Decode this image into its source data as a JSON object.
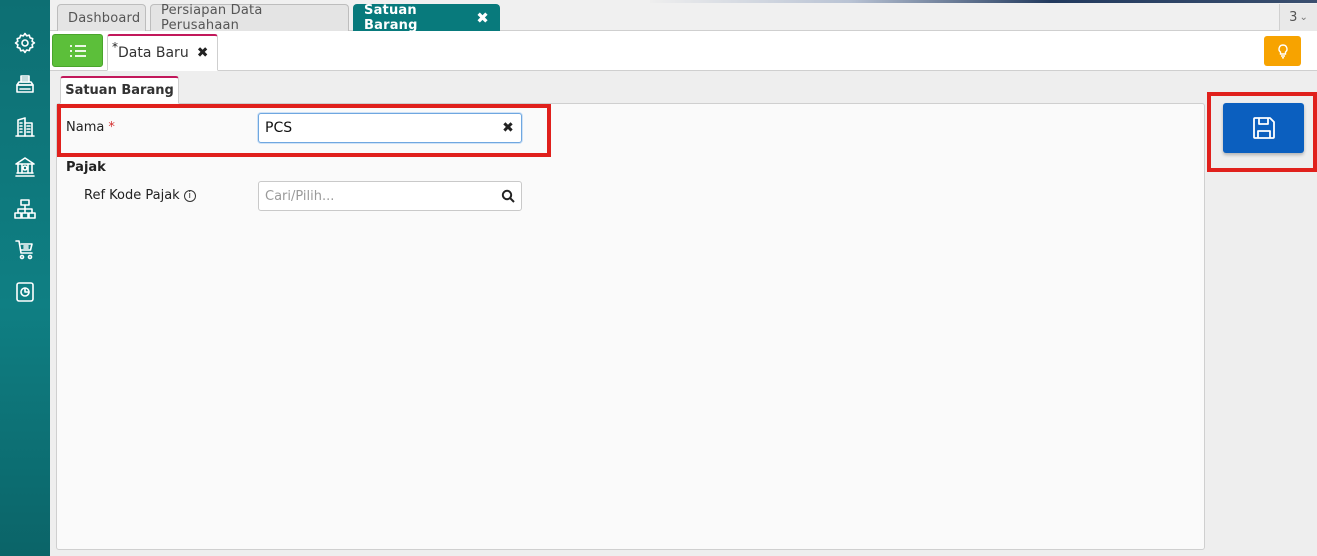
{
  "sidebar": {
    "icons": [
      "gear-icon",
      "printer-icon",
      "building-icon",
      "bank-icon",
      "network-icon",
      "cart-icon",
      "report-icon"
    ]
  },
  "top_tabs": [
    {
      "label": "Dashboard",
      "active": false
    },
    {
      "label": "Persiapan Data Perusahaan",
      "active": false
    },
    {
      "label": "Satuan Barang",
      "active": true,
      "close": "✖"
    }
  ],
  "tab_count": "3",
  "subbar": {
    "doc_tab": {
      "modified_mark": "*",
      "label": "Data Baru",
      "close": "✖"
    }
  },
  "form": {
    "tab_label": "Satuan Barang",
    "nama_label": "Nama",
    "required_mark": "*",
    "nama_value": "PCS",
    "clear_symbol": "✖",
    "section_pajak": "Pajak",
    "ref_kode_pajak_label": "Ref Kode Pajak",
    "info_symbol": "i",
    "ref_kode_pajak_placeholder": "Cari/Pilih..."
  },
  "colors": {
    "sidebar": "#0f7f83",
    "active_tab": "#087a7c",
    "list_button": "#5cbf3a",
    "bulb_button": "#f7a300",
    "save_button": "#0b5fbf",
    "highlight": "#e0201c",
    "tab_accent": "#c2185b"
  }
}
